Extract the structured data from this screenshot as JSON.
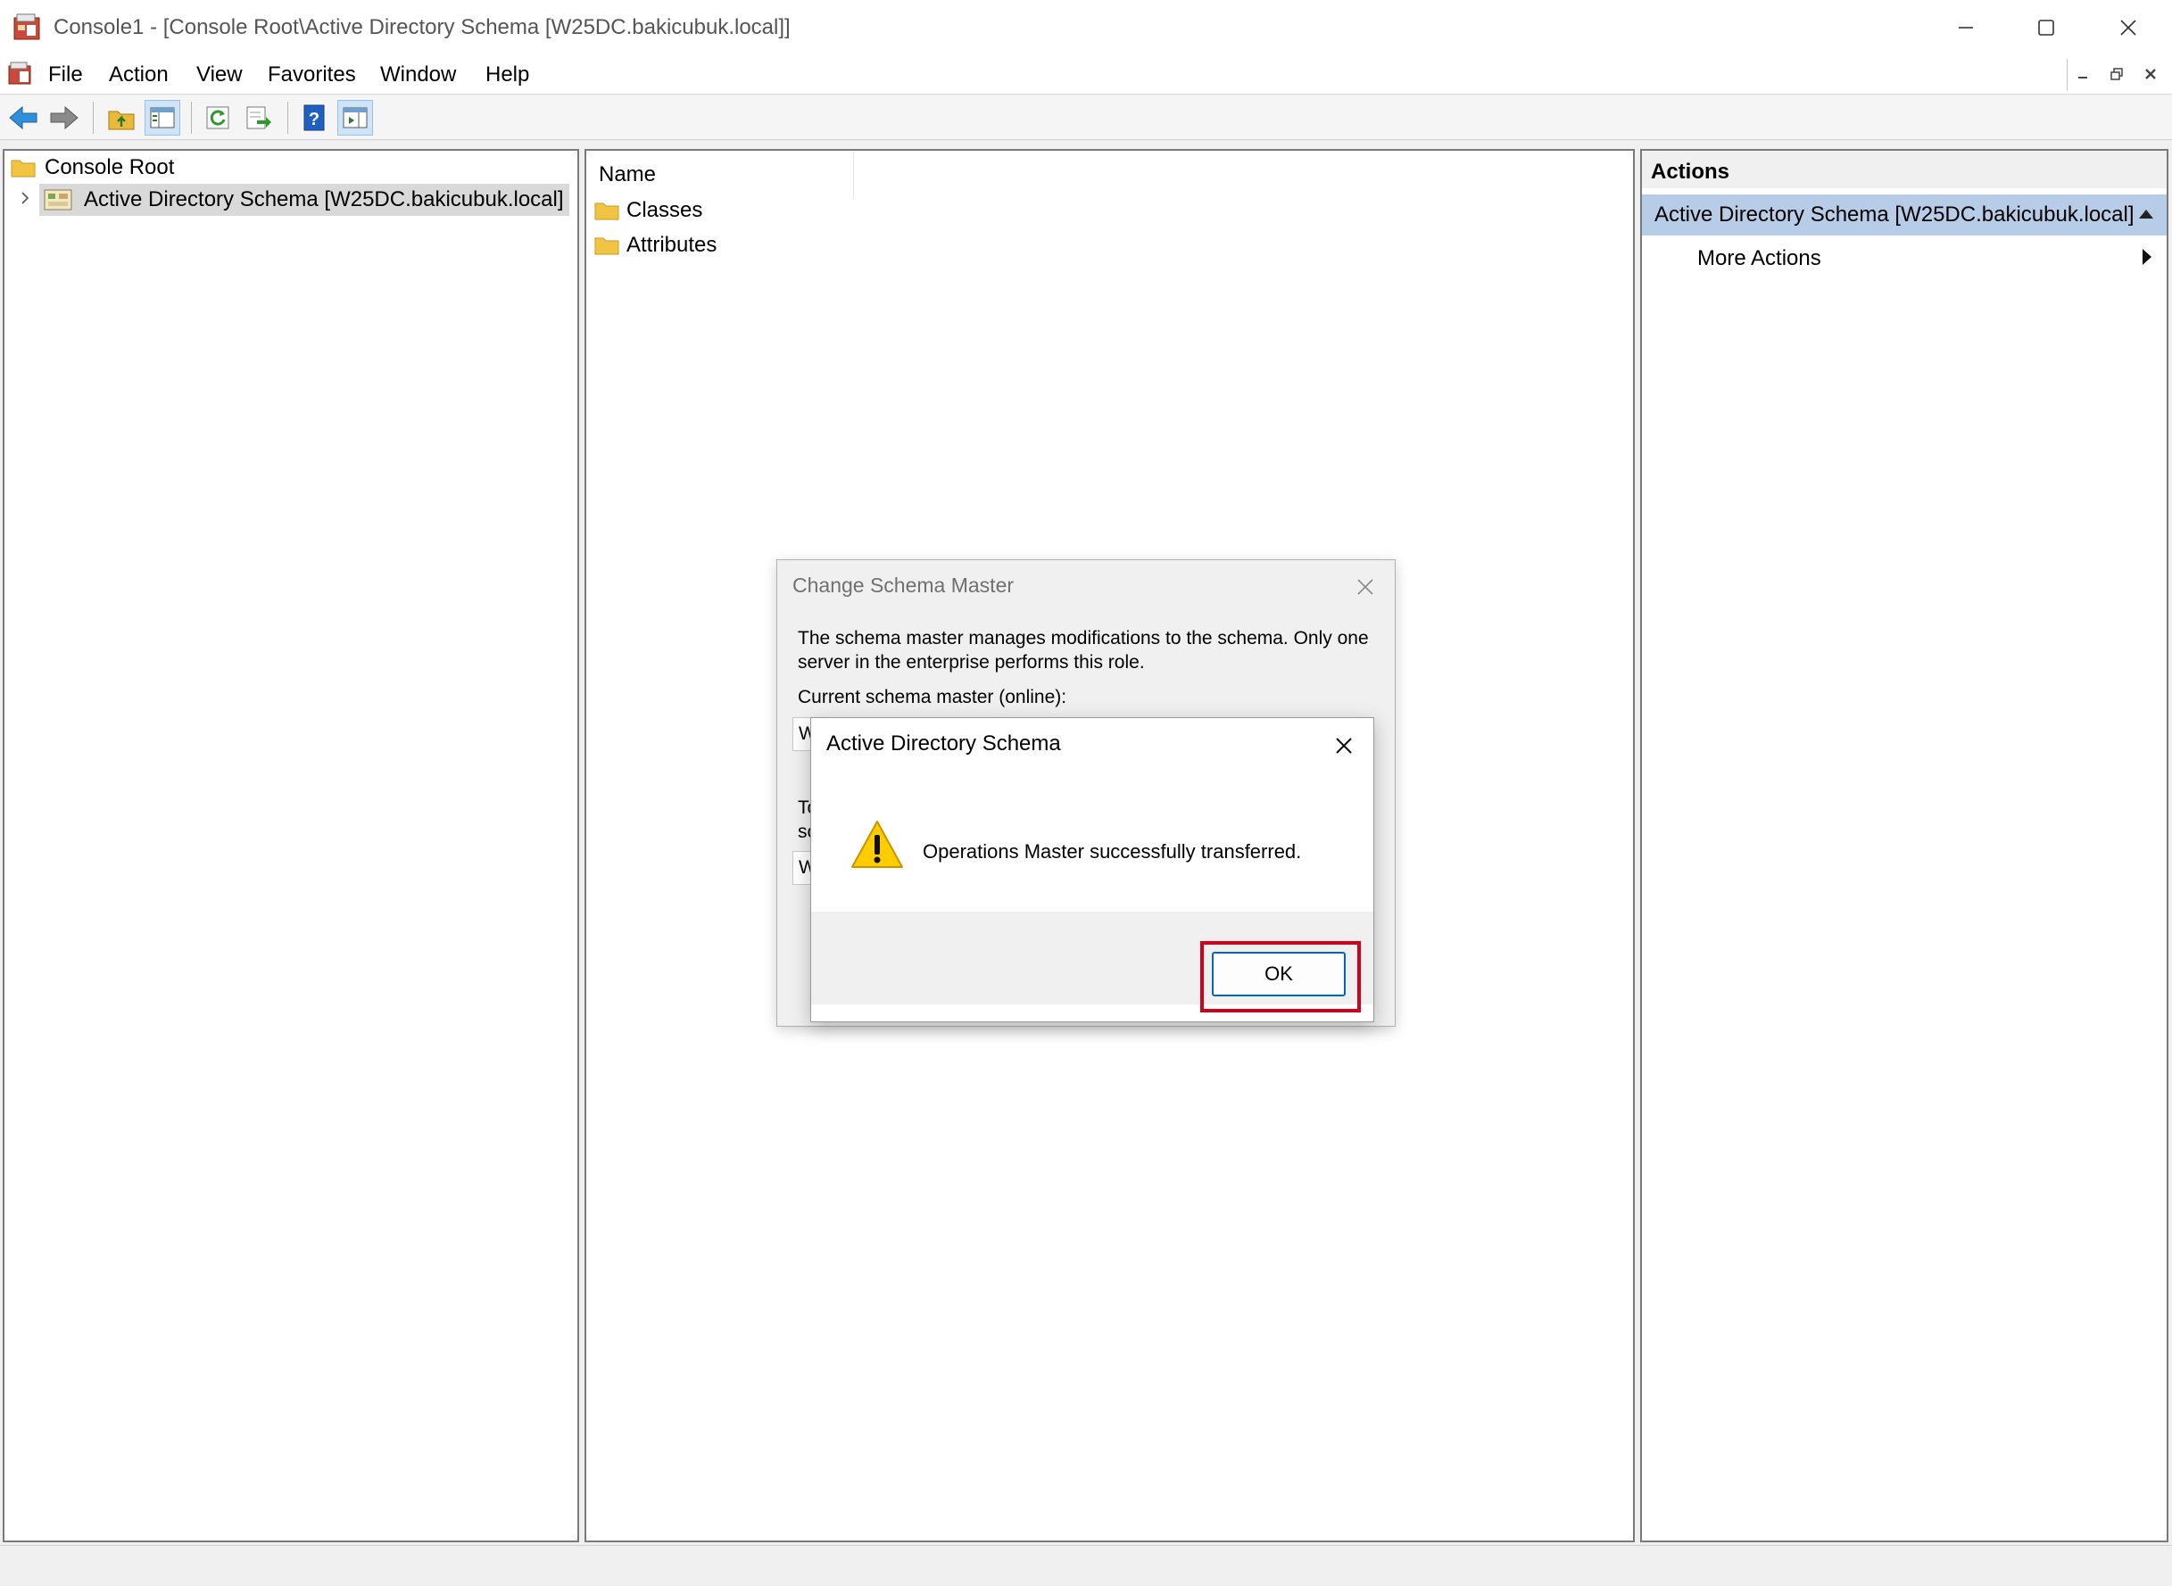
{
  "window": {
    "title": "Console1 - [Console Root\\Active Directory Schema [W25DC.bakicubuk.local]]"
  },
  "menu": [
    "File",
    "Action",
    "View",
    "Favorites",
    "Window",
    "Help"
  ],
  "toolbar": {
    "buttons": [
      "back-arrow-icon",
      "forward-arrow-icon",
      "up-folder-icon",
      "show-hide-tree-icon",
      "refresh-icon",
      "export-list-icon",
      "help-icon",
      "show-hide-action-pane-icon"
    ]
  },
  "tree": {
    "root_label": "Console Root",
    "child_label": "Active Directory Schema [W25DC.bakicubuk.local]"
  },
  "list": {
    "column_header": "Name",
    "items": [
      "Classes",
      "Attributes"
    ]
  },
  "actions": {
    "header": "Actions",
    "section_title": "Active Directory Schema [W25DC.bakicubuk.local]",
    "more_actions": "More Actions"
  },
  "change_schema_dialog": {
    "title": "Change Schema Master",
    "description": "The schema master manages modifications to the schema. Only one server in the enterprise performs this role.",
    "current_label": "Current schema master (online):",
    "current_value": "W",
    "to_label": "To\nsc",
    "target_value": "W"
  },
  "message_box": {
    "title": "Active Directory Schema",
    "message": "Operations Master successfully transferred.",
    "ok_label": "OK"
  },
  "colors": {
    "selection": "#b7cce6",
    "ok_border": "#0067c0",
    "highlight_box": "#d1001c",
    "warning_yellow": "#ffcc00"
  }
}
